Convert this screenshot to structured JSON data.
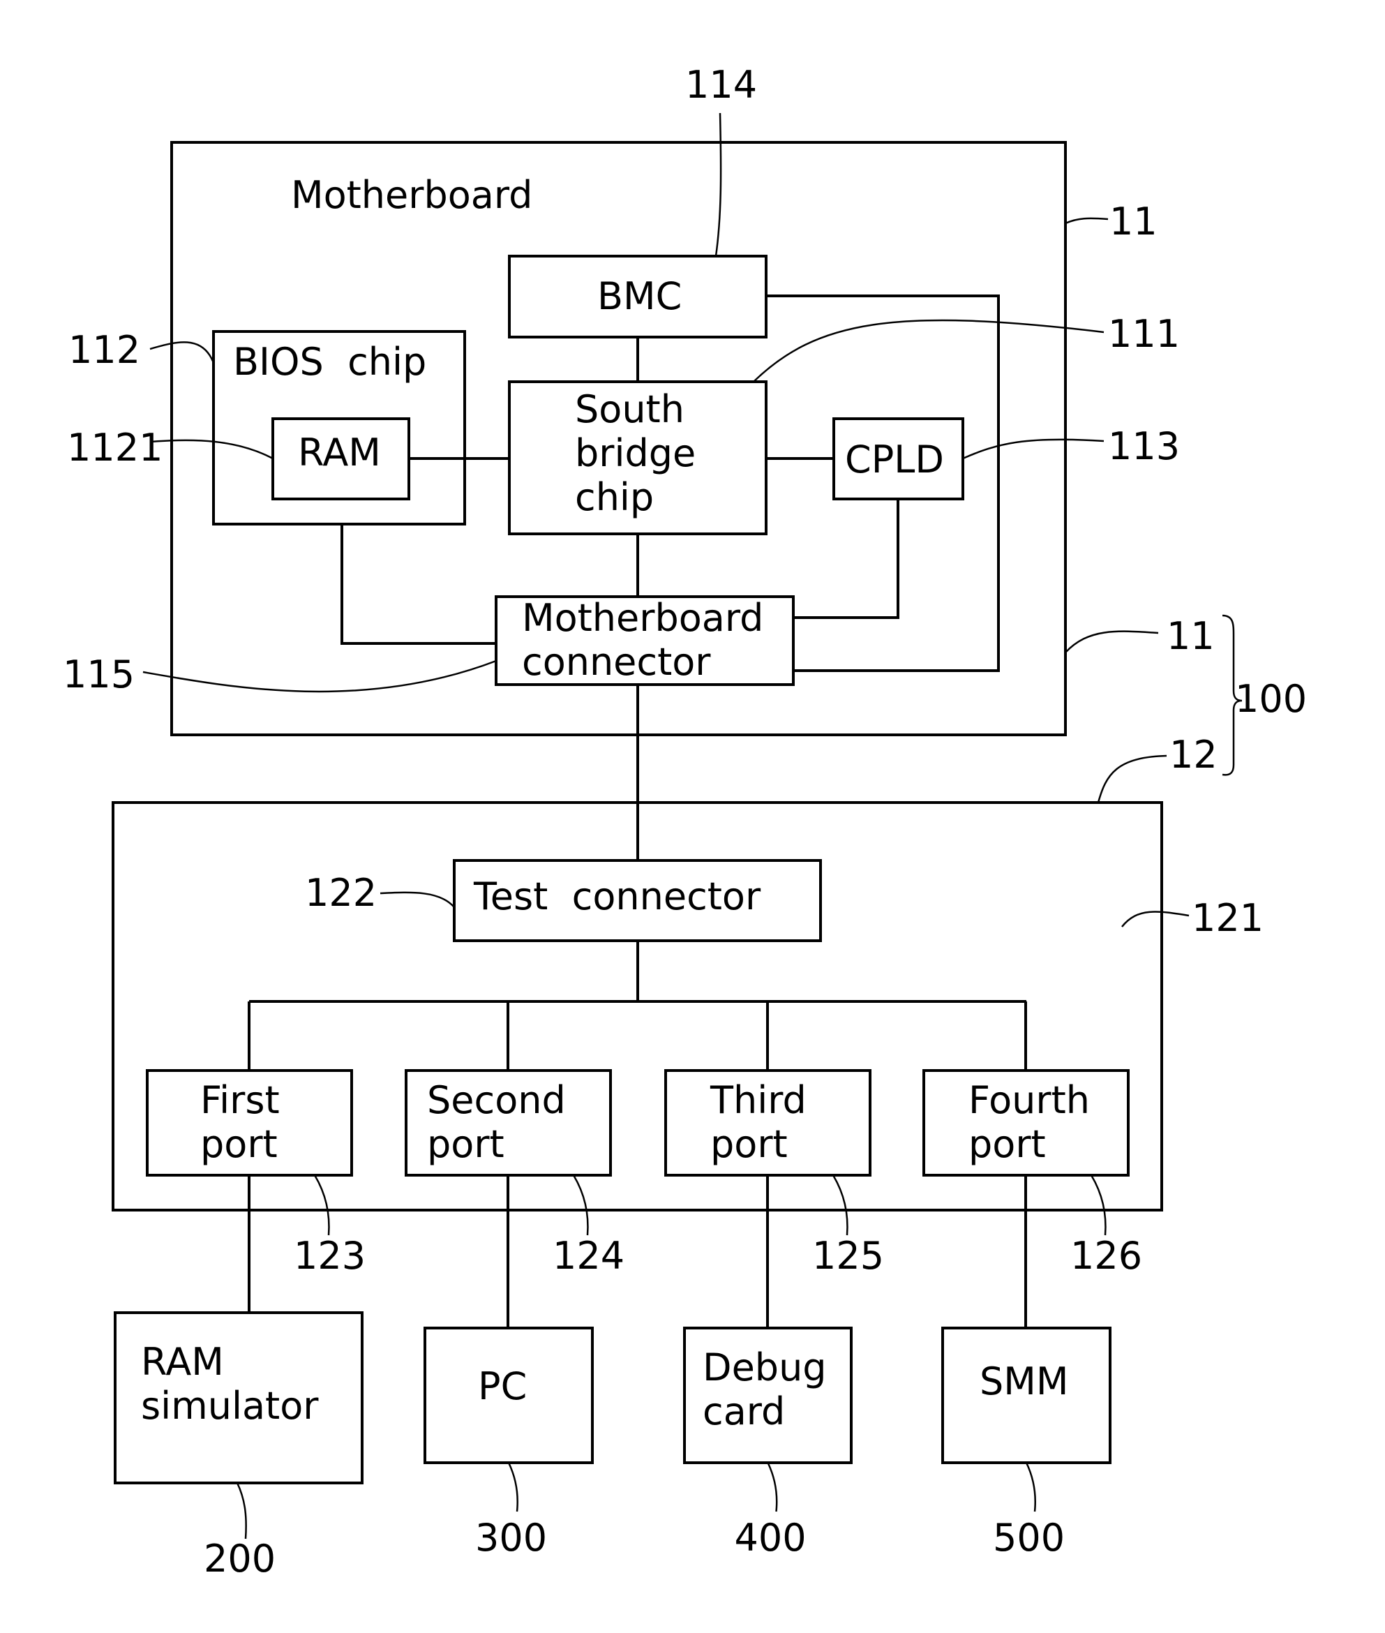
{
  "diagram": {
    "blocks": {
      "motherboard": {
        "title": "Motherboard",
        "ref": "11"
      },
      "bmc": {
        "label": "BMC",
        "ref": "114"
      },
      "bios": {
        "label": "BIOS  chip",
        "ref": "112"
      },
      "ram": {
        "label": "RAM",
        "ref": "1121"
      },
      "southbridge": {
        "lines": [
          "South",
          "bridge",
          "chip"
        ],
        "ref": "111"
      },
      "cpld": {
        "label": "CPLD",
        "ref": "113"
      },
      "mbconnector": {
        "lines": [
          "Motherboard",
          "connector"
        ],
        "ref": "115"
      },
      "testboard": {
        "ref": "12",
        "ref_inner": "121"
      },
      "testconnector": {
        "label": "Test  connector",
        "ref": "122"
      },
      "ports": [
        {
          "lines": [
            "First",
            "port"
          ],
          "ref": "123"
        },
        {
          "lines": [
            "Second",
            "port"
          ],
          "ref": "124"
        },
        {
          "lines": [
            "Third",
            "port"
          ],
          "ref": "125"
        },
        {
          "lines": [
            "Fourth",
            "port"
          ],
          "ref": "126"
        }
      ],
      "devices": [
        {
          "lines": [
            "RAM",
            "simulator"
          ],
          "ref": "200"
        },
        {
          "lines": [
            "PC"
          ],
          "ref": "300"
        },
        {
          "lines": [
            "Debug",
            "card"
          ],
          "ref": "400"
        },
        {
          "lines": [
            "SMM"
          ],
          "ref": "500"
        }
      ]
    },
    "labels": {
      "mb_ref_top": "11",
      "mb_ref_mid": "11",
      "system_ref": "100"
    }
  }
}
